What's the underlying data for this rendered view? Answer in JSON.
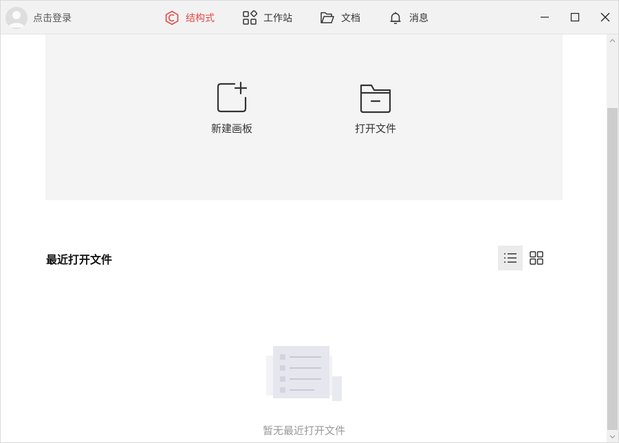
{
  "header": {
    "login_label": "点击登录",
    "nav": [
      {
        "label": "结构式",
        "icon": "structure-icon",
        "active": true
      },
      {
        "label": "工作站",
        "icon": "workstation-icon",
        "active": false
      },
      {
        "label": "文档",
        "icon": "folder-icon",
        "active": false
      },
      {
        "label": "消息",
        "icon": "bell-icon",
        "active": false
      }
    ],
    "accent_color": "#e54545"
  },
  "actions": {
    "new_canvas": {
      "label": "新建画板",
      "icon": "new-canvas-icon"
    },
    "open_file": {
      "label": "打开文件",
      "icon": "open-file-icon"
    }
  },
  "recent": {
    "title": "最近打开文件",
    "view_modes": [
      "list-view-icon",
      "grid-view-icon"
    ],
    "active_view": "list",
    "empty_text": "暂无最近打开文件"
  }
}
